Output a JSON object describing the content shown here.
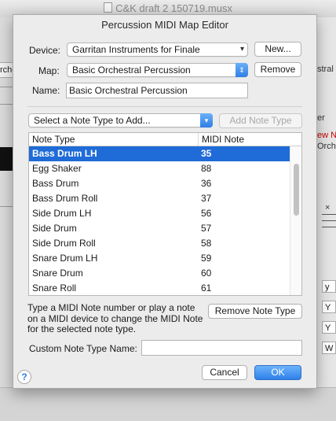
{
  "background_window": {
    "title": "C&K draft 2 150719.musx",
    "left_tab": "rche",
    "right_texts": [
      "stral P",
      "er",
      "ew N",
      "Orche"
    ],
    "right_boxes": [
      "y",
      "Y",
      "Y",
      "W"
    ],
    "close_mark": "×"
  },
  "dialog": {
    "title": "Percussion MIDI Map Editor",
    "device_label": "Device:",
    "device_value": "Garritan Instruments for Finale",
    "new_button": "New...",
    "map_label": "Map:",
    "map_value": "Basic Orchestral Percussion",
    "remove_button": "Remove",
    "name_label": "Name:",
    "name_value": "Basic Orchestral Percussion",
    "note_type_popup": "Select a Note Type to Add...",
    "add_note_type_button": "Add Note Type",
    "table": {
      "headers": [
        "Note Type",
        "MIDI Note"
      ],
      "rows": [
        {
          "name": "Bass Drum LH",
          "midi": "35",
          "selected": true
        },
        {
          "name": "Egg Shaker",
          "midi": "88"
        },
        {
          "name": "Bass Drum",
          "midi": "36"
        },
        {
          "name": "Bass Drum Roll",
          "midi": "37"
        },
        {
          "name": "Side Drum LH",
          "midi": "56"
        },
        {
          "name": "Side Drum",
          "midi": "57"
        },
        {
          "name": "Side Drum Roll",
          "midi": "58"
        },
        {
          "name": "Snare Drum LH",
          "midi": "59"
        },
        {
          "name": "Snare Drum",
          "midi": "60"
        },
        {
          "name": "Snare Roll",
          "midi": "61"
        }
      ]
    },
    "help_text": "Type a MIDI Note number or play a note on a MIDI device to change the MIDI Note for the selected note type.",
    "remove_note_type_button": "Remove Note Type",
    "custom_label": "Custom Note Type Name:",
    "custom_value": "",
    "help_button": "?",
    "cancel_button": "Cancel",
    "ok_button": "OK"
  },
  "colors": {
    "selection": "#1f6bd8",
    "default_button": "#2f80ea"
  },
  "icons": {
    "popup_arrow": "chevron-down-icon",
    "stepper_arrow": "up-down-arrows-icon",
    "help": "question-icon",
    "document": "document-icon"
  }
}
